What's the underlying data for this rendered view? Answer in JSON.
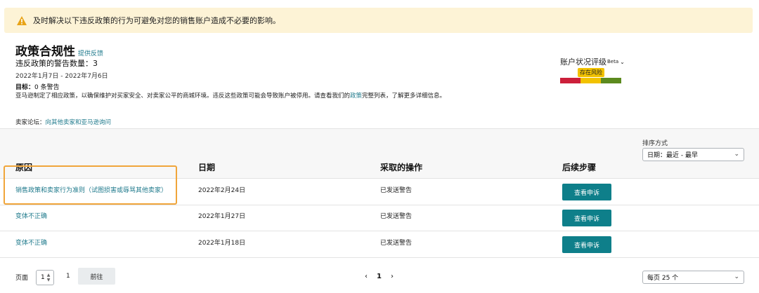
{
  "banner": {
    "icon": "warning-icon",
    "text": "及时解决以下违反政策的行为可避免对您的销售账户造成不必要的影响。"
  },
  "header": {
    "title": "政策合规性",
    "feedback_link": "提供反馈",
    "violation_count": "违反政策的警告数量：3",
    "date_range": "2022年1月7日 - 2022年7月6日",
    "target_label": "目标：",
    "target_value": "0 条警告",
    "description_before": "亚马逊制定了相应政策，以确保维护对买家安全、对卖家公平的商城环境。违反这些政策可能会导致账户被停用。请查看我们的",
    "description_link": "政策",
    "description_after": "完整列表，了解更多详细信息。",
    "forum_label": "卖家论坛：",
    "forum_link": "向其他卖家和亚马逊询问"
  },
  "account_rating": {
    "label": "账户状况评级",
    "superscript": "Beta",
    "badge": "存在风险",
    "colors": {
      "red": "#cc1f3a",
      "yellow": "#f2c200",
      "green": "#5c8a1e"
    }
  },
  "sort": {
    "label": "排序方式",
    "value": "日期：最近 - 最早"
  },
  "table": {
    "headers": {
      "reason": "原因",
      "date": "日期",
      "action": "采取的操作",
      "next": "后续步骤"
    },
    "rows": [
      {
        "reason": "销售政策和卖家行为准则（试图损害或辱骂其他卖家）",
        "date": "2022年2月24日",
        "action": "已发送警告",
        "button": "查看申诉"
      },
      {
        "reason": "变体不正确",
        "date": "2022年1月27日",
        "action": "已发送警告",
        "button": "查看申诉"
      },
      {
        "reason": "变体不正确",
        "date": "2022年1月18日",
        "action": "已发送警告",
        "button": "查看申诉"
      }
    ]
  },
  "pagination": {
    "page_label": "页面",
    "page_input": "1",
    "total_pages": "1",
    "goto": "前往",
    "current": "1",
    "per_page": "每页 25 个"
  },
  "colors": {
    "link": "#1f7a8c",
    "button": "#0e7f8a",
    "banner_bg": "#fdf3d6",
    "highlight": "#f0a53a"
  }
}
